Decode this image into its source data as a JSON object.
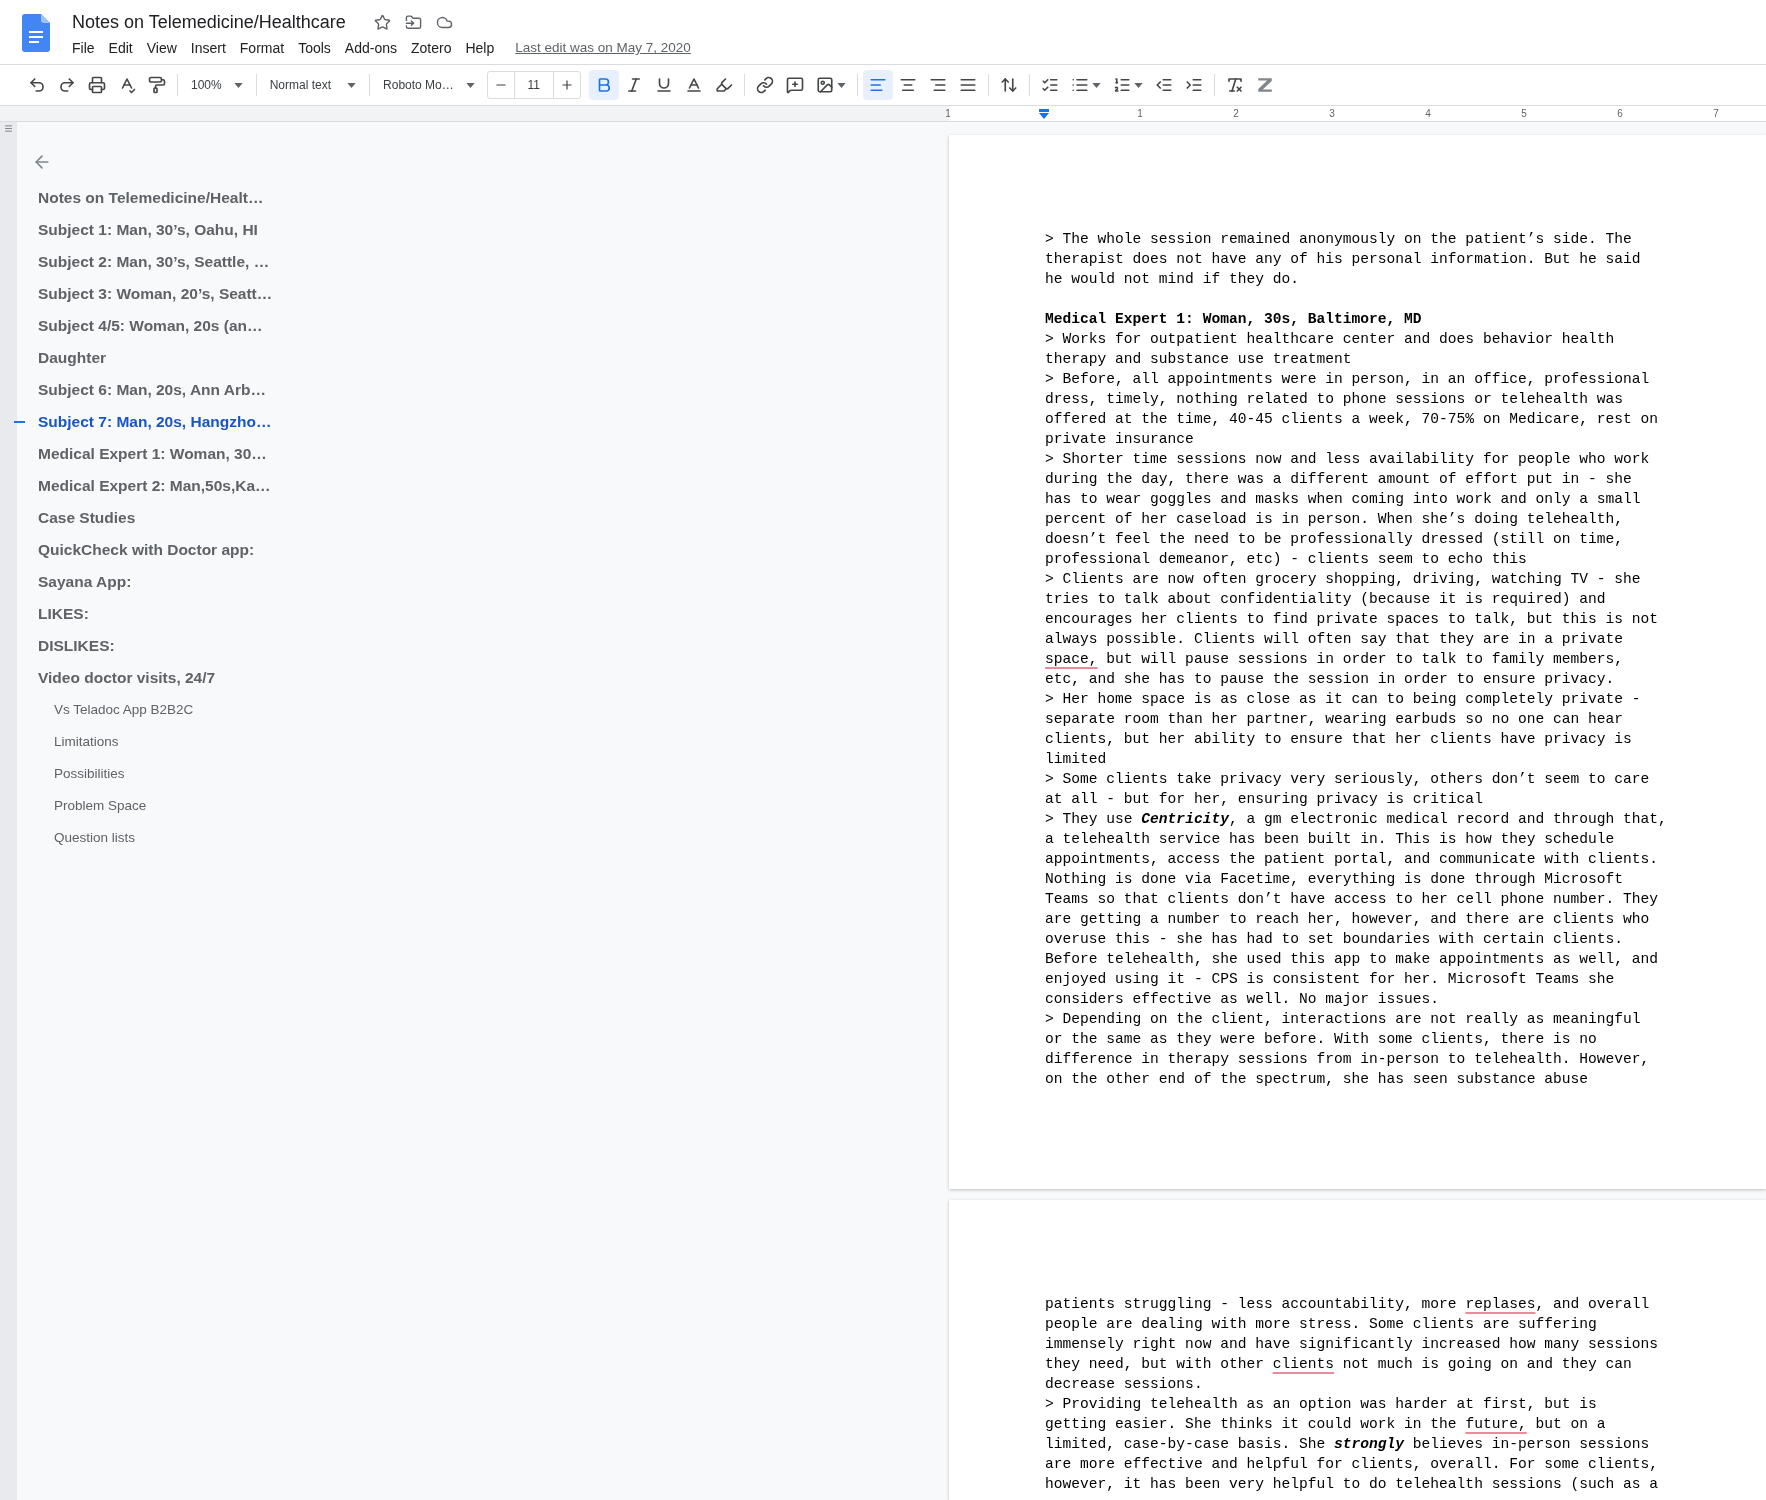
{
  "header": {
    "title": "Notes on Telemedicine/Healthcare",
    "menu": [
      "File",
      "Edit",
      "View",
      "Insert",
      "Format",
      "Tools",
      "Add-ons",
      "Zotero",
      "Help"
    ],
    "last_edit": "Last edit was on May 7, 2020"
  },
  "toolbar": {
    "history": [
      {
        "kind": "undo"
      },
      {
        "kind": "redo"
      },
      {
        "kind": "print"
      },
      {
        "kind": "spellcheck"
      },
      {
        "kind": "paint_format"
      }
    ],
    "zoom": "100%",
    "style": "Normal text",
    "font": "Roboto Mo…",
    "font_size": "11",
    "text_format": [
      {
        "kind": "bold",
        "selected": true
      },
      {
        "kind": "italic",
        "selected": false
      },
      {
        "kind": "underline",
        "selected": false
      },
      {
        "kind": "text_color",
        "selected": false
      },
      {
        "kind": "highlight",
        "selected": false
      }
    ],
    "insert": [
      {
        "kind": "link"
      },
      {
        "kind": "comment"
      },
      {
        "kind": "image"
      }
    ],
    "align": [
      {
        "kind": "align_left",
        "selected": true
      },
      {
        "kind": "align_center",
        "selected": false
      },
      {
        "kind": "align_right",
        "selected": false
      },
      {
        "kind": "justify",
        "selected": false
      }
    ],
    "spacing": [
      {
        "kind": "line_spacing"
      }
    ],
    "lists": [
      {
        "kind": "checklist"
      },
      {
        "kind": "bulleted"
      },
      {
        "kind": "numbered"
      },
      {
        "kind": "outdent"
      },
      {
        "kind": "indent"
      }
    ],
    "extra": [
      {
        "kind": "clear_formatting"
      },
      {
        "kind": "zotero"
      }
    ]
  },
  "ruler": {
    "labels": [
      "1",
      "1",
      "2",
      "3",
      "4",
      "5",
      "6",
      "7"
    ]
  },
  "outline": [
    {
      "text": "Notes on Telemedicine/Healt…",
      "selected": false
    },
    {
      "text": "Subject 1: Man, 30’s, Oahu, HI",
      "selected": false
    },
    {
      "text": "Subject 2: Man, 30’s, Seattle, …",
      "selected": false
    },
    {
      "text": "Subject 3: Woman, 20’s, Seatt…",
      "selected": false
    },
    {
      "text": "Subject 4/5: Woman, 20s (an…",
      "selected": false
    },
    {
      "text": "Daughter",
      "selected": false
    },
    {
      "text": "Subject 6: Man, 20s, Ann Arb…",
      "selected": false
    },
    {
      "text": "Subject 7: Man, 20s, Hangzho…",
      "selected": true
    },
    {
      "text": "Medical Expert 1: Woman, 30…",
      "selected": false
    },
    {
      "text": "Medical Expert 2: Man,50s,Ka…",
      "selected": false
    },
    {
      "text": "Case Studies",
      "selected": false
    },
    {
      "text": "QuickCheck with Doctor app:",
      "selected": false
    },
    {
      "text": "Sayana App:",
      "selected": false
    },
    {
      "text": "LIKES:",
      "selected": false
    },
    {
      "text": "DISLIKES:",
      "selected": false
    },
    {
      "text": "Video doctor visits, 24/7",
      "selected": false,
      "children": [
        {
          "text": "Vs Teladoc App B2B2C",
          "selected": false
        },
        {
          "text": "Limitations",
          "selected": false
        },
        {
          "text": "Possibilities",
          "selected": false
        },
        {
          "text": "Problem Space",
          "selected": false
        },
        {
          "text": "Question lists",
          "selected": false
        }
      ]
    }
  ],
  "pages": [
    {
      "blocks": [
        {
          "kind": "para",
          "lines": [
            "> The whole session remained anonymously on the patient’s side. The",
            "therapist does not have any of his personal information. But he said",
            "he would not mind if they do."
          ]
        },
        {
          "kind": "heading",
          "text": "Medical Expert 1: Woman, 30s, Baltimore, MD"
        },
        {
          "kind": "para",
          "lines": [
            "> Works for outpatient healthcare center and does behavior health",
            "therapy and substance use treatment",
            "> Before, all appointments were in person, in an office, professional",
            "dress, timely, nothing related to phone sessions or telehealth was",
            "offered at the time, 40-45 clients a week, 70-75% on Medicare, rest on",
            "private insurance",
            "> Shorter time sessions now and less availability for people who work",
            "during the day, there was a different amount of effort put in - she",
            "has to wear goggles and masks when coming into work and only a small",
            "percent of her caseload is in person. When she’s doing telehealth,",
            "doesn’t feel the need to be professionally dressed (still on time,",
            "professional demeanor, etc) - clients seem to echo this",
            "> Clients are now often grocery shopping, driving, watching TV - she",
            "tries to talk about confidentiality (because it is required) and",
            "encourages her clients to find private spaces to talk, but this is not",
            "always possible. Clients will often say that they are in a private",
            {
              "parts": [
                {
                  "text": "space,",
                  "misspelled": true
                },
                {
                  "text": " but will pause sessions in order to talk to family members,",
                  "misspelled": false
                }
              ]
            },
            "etc, and she has to pause the session in order to ensure privacy.",
            "> Her home space is as close as it can to being completely private -",
            "separate room than her partner, wearing earbuds so no one can hear",
            "clients, but her ability to ensure that her clients have privacy is",
            "limited",
            "> Some clients take privacy very seriously, others don’t seem to care",
            "at all - but for her, ensuring privacy is critical",
            "> They use **Centricity**, a gm electronic medical record and through that,",
            "a telehealth service has been built in. This is how they schedule",
            "appointments, access the patient portal, and communicate with clients.",
            "Nothing is done via Facetime, everything is done through Microsoft",
            "Teams so that clients don’t have access to her cell phone number. They",
            "are getting a number to reach her, however, and there are clients who",
            "overuse this - she has had to set boundaries with certain clients.",
            "Before telehealth, she used this app to make appointments as well, and",
            "enjoyed using it - CPS is consistent for her. Microsoft Teams she",
            "considers effective as well. No major issues.",
            "> Depending on the client, interactions are not really as meaningful",
            "or the same as they were before. With some clients, there is no",
            "difference in therapy sessions from in-person to telehealth. However,",
            "on the other end of the spectrum, she has seen substance abuse"
          ]
        }
      ]
    },
    {
      "blocks": [
        {
          "kind": "para",
          "lines": [
            {
              "parts": [
                {
                  "text": "patients struggling - less accountability, more ",
                  "misspelled": false
                },
                {
                  "text": "replases",
                  "misspelled": true
                },
                {
                  "text": ", and overall",
                  "misspelled": false
                }
              ]
            },
            "people are dealing with more stress. Some clients are suffering",
            "immensely right now and have significantly increased how many sessions",
            {
              "parts": [
                {
                  "text": "they need, but with other ",
                  "misspelled": false
                },
                {
                  "text": "clients",
                  "misspelled": true
                },
                {
                  "text": " not much is going on and they can",
                  "misspelled": false
                }
              ]
            },
            "decrease sessions.",
            "> Providing telehealth as an option was harder at first, but is",
            {
              "parts": [
                {
                  "text": "getting easier. She thinks it could work in the ",
                  "misspelled": false
                },
                {
                  "text": "future,",
                  "misspelled": true
                },
                {
                  "text": " but on a",
                  "misspelled": false
                }
              ]
            },
            "limited, case-by-case basis. She **strongly** believes in-person sessions",
            "are more effective and helpful for clients, overall. For some clients,",
            "however, it has been very helpful to do telehealth sessions (such as a"
          ]
        }
      ]
    }
  ]
}
